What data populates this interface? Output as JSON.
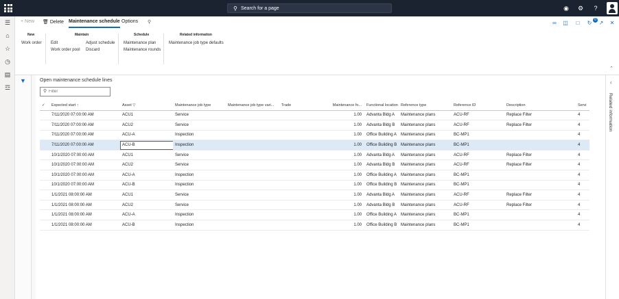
{
  "topbar": {
    "search_placeholder": "Search for a page",
    "icons": [
      "waffle-icon",
      "lightbulb-icon",
      "gear-icon",
      "help-icon",
      "user-icon"
    ]
  },
  "leftnav": [
    "menu-icon",
    "home-icon",
    "star-icon",
    "clock-icon",
    "workspace-icon",
    "list-icon"
  ],
  "actionpane": {
    "new_label": "New",
    "delete_label": "Delete",
    "tabs": [
      "Maintenance schedule",
      "Options"
    ],
    "groups": {
      "new": {
        "title": "New",
        "items": [
          "Work order"
        ]
      },
      "maintain": {
        "title": "Maintain",
        "items": [
          "Edit",
          "Work order pool",
          "Adjust schedule",
          "Discard"
        ]
      },
      "schedule": {
        "title": "Schedule",
        "items": [
          "Maintenance plan",
          "Maintenance rounds"
        ]
      },
      "related": {
        "title": "Related information",
        "items": [
          "Maintenance job type defaults"
        ]
      }
    },
    "badge_count": "0"
  },
  "panel": {
    "title": "Open maintenance schedule lines",
    "filter_placeholder": "Filter"
  },
  "grid": {
    "columns": [
      "Expected start",
      "Asset",
      "Maintenance job type",
      "Maintenance job type vari...",
      "Trade",
      "Maintenance fo...",
      "Functional location",
      "Reference type",
      "Reference ID",
      "Description",
      "Servi"
    ],
    "rows": [
      [
        "7/11/2020 07:00:00 AM",
        "ACU1",
        "Service",
        "",
        "",
        "1.00",
        "Advanta Bldg A",
        "Maintenance plans",
        "ACU-RF",
        "Replace Filter",
        "4"
      ],
      [
        "7/11/2020 07:00:00 AM",
        "ACU2",
        "Service",
        "",
        "",
        "1.00",
        "Advanta Bldg B",
        "Maintenance plans",
        "ACU-RF",
        "Replace Filter",
        "4"
      ],
      [
        "7/11/2020 07:00:00 AM",
        "ACU-A",
        "Inspection",
        "",
        "",
        "1.00",
        "Office Building A",
        "Maintenance plans",
        "BC-MP1",
        "",
        "4"
      ],
      [
        "7/11/2020 07:00:00 AM",
        "ACU-B",
        "Inspection",
        "",
        "",
        "1.00",
        "Office Building B",
        "Maintenance plans",
        "BC-MP1",
        "",
        "4"
      ],
      [
        "10/1/2020 07:00:00 AM",
        "ACU1",
        "Service",
        "",
        "",
        "1.00",
        "Advanta Bldg A",
        "Maintenance plans",
        "ACU-RF",
        "Replace Filter",
        "4"
      ],
      [
        "10/1/2020 07:00:00 AM",
        "ACU2",
        "Service",
        "",
        "",
        "1.00",
        "Advanta Bldg B",
        "Maintenance plans",
        "ACU-RF",
        "Replace Filter",
        "4"
      ],
      [
        "10/1/2020 07:00:00 AM",
        "ACU-A",
        "Inspection",
        "",
        "",
        "1.00",
        "Office Building A",
        "Maintenance plans",
        "BC-MP1",
        "",
        "4"
      ],
      [
        "10/1/2020 07:00:00 AM",
        "ACU-B",
        "Inspection",
        "",
        "",
        "1.00",
        "Office Building B",
        "Maintenance plans",
        "BC-MP1",
        "",
        "4"
      ],
      [
        "1/1/2021 08:00:00 AM",
        "ACU1",
        "Service",
        "",
        "",
        "1.00",
        "Advanta Bldg A",
        "Maintenance plans",
        "ACU-RF",
        "Replace Filter",
        "4"
      ],
      [
        "1/1/2021 08:00:00 AM",
        "ACU2",
        "Service",
        "",
        "",
        "1.00",
        "Advanta Bldg B",
        "Maintenance plans",
        "ACU-RF",
        "Replace Filter",
        "4"
      ],
      [
        "1/1/2021 08:00:00 AM",
        "ACU-A",
        "Inspection",
        "",
        "",
        "1.00",
        "Office Building A",
        "Maintenance plans",
        "BC-MP1",
        "",
        "4"
      ],
      [
        "1/1/2021 08:00:00 AM",
        "ACU-B",
        "Inspection",
        "",
        "",
        "1.00",
        "Office Building B",
        "Maintenance plans",
        "BC-MP1",
        "",
        "4"
      ]
    ],
    "selected_row": 3
  },
  "rightpanel": {
    "label": "Related information"
  },
  "colors": {
    "topbar": "#1b2330",
    "accent": "#0f6cbd",
    "selected_row": "#dce9f7"
  }
}
